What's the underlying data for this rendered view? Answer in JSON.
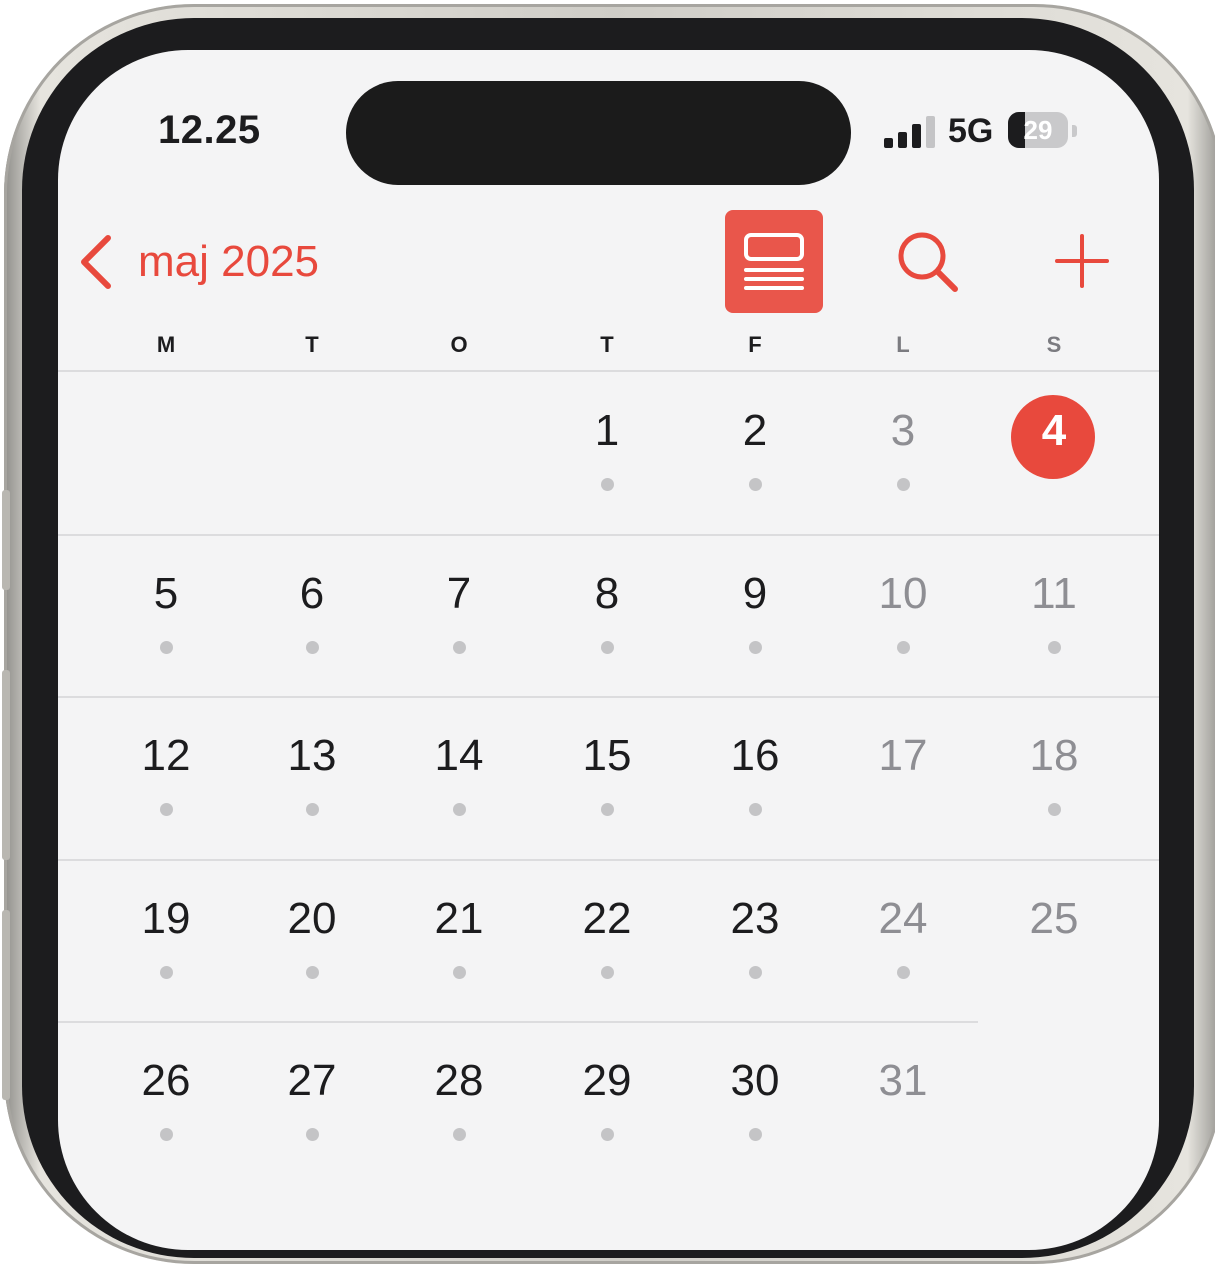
{
  "status_bar": {
    "time": "12.25",
    "network": "5G",
    "battery": "29"
  },
  "header": {
    "back_label": "maj 2025",
    "accent_color": "#e8493d",
    "view_icon": "list-view-icon",
    "search_icon": "search-icon",
    "add_icon": "plus-icon"
  },
  "weekdays": [
    "M",
    "T",
    "O",
    "T",
    "F",
    "L",
    "S"
  ],
  "weeks": [
    {
      "days": [
        "",
        "",
        "",
        "1",
        "2",
        "3",
        "4"
      ],
      "dots": [
        false,
        false,
        false,
        true,
        true,
        true,
        false
      ]
    },
    {
      "days": [
        "5",
        "6",
        "7",
        "8",
        "9",
        "10",
        "11"
      ],
      "dots": [
        true,
        true,
        true,
        true,
        true,
        true,
        true
      ]
    },
    {
      "days": [
        "12",
        "13",
        "14",
        "15",
        "16",
        "17",
        "18"
      ],
      "dots": [
        true,
        true,
        true,
        true,
        true,
        false,
        true
      ]
    },
    {
      "days": [
        "19",
        "20",
        "21",
        "22",
        "23",
        "24",
        "25"
      ],
      "dots": [
        true,
        true,
        true,
        true,
        true,
        true,
        false
      ]
    },
    {
      "days": [
        "26",
        "27",
        "28",
        "29",
        "30",
        "31",
        ""
      ],
      "dots": [
        true,
        true,
        true,
        true,
        true,
        false,
        false
      ]
    }
  ],
  "today": "4"
}
